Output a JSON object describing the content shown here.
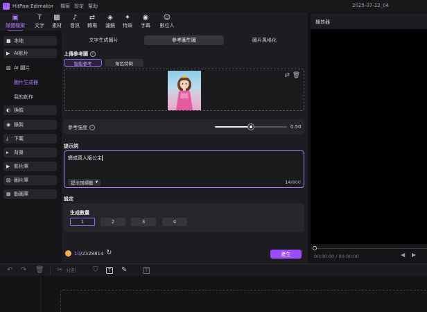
{
  "app": {
    "name": "HitPaw Edimakor",
    "menu": [
      "檔案",
      "設定",
      "幫助"
    ],
    "project_date": "2025-07-22_04"
  },
  "toolbar": [
    {
      "label": "媒體檔案",
      "icon": "media-icon",
      "glyph": "▣",
      "active": true
    },
    {
      "label": "文字",
      "icon": "text-icon",
      "glyph": "T"
    },
    {
      "label": "素材",
      "icon": "material-icon",
      "glyph": "▩"
    },
    {
      "label": "音訊",
      "icon": "audio-icon",
      "glyph": "♪"
    },
    {
      "label": "轉場",
      "icon": "transition-icon",
      "glyph": "⇄"
    },
    {
      "label": "濾鏡",
      "icon": "filter-icon",
      "glyph": "◈"
    },
    {
      "label": "特效",
      "icon": "effect-icon",
      "glyph": "✦"
    },
    {
      "label": "字幕",
      "icon": "subtitle-icon",
      "glyph": "◉"
    },
    {
      "label": "數位人",
      "icon": "digital-human-icon",
      "glyph": "☺"
    }
  ],
  "sidebar": {
    "items": [
      {
        "label": "本地",
        "icon": "folder-icon",
        "glyph": "■"
      },
      {
        "label": "AI影片",
        "icon": "ai-video-icon",
        "glyph": "▶"
      },
      {
        "label": "AI 圖片",
        "icon": "ai-image-icon",
        "glyph": "▨"
      },
      {
        "label": "換臉",
        "icon": "face-swap-icon",
        "glyph": "◐"
      },
      {
        "label": "錄製",
        "icon": "record-icon",
        "glyph": "◉"
      },
      {
        "label": "下載",
        "icon": "download-icon",
        "glyph": "⤓"
      },
      {
        "label": "背景",
        "icon": "background-icon",
        "glyph": "▸"
      },
      {
        "label": "影片庫",
        "icon": "video-library-icon",
        "glyph": "▶"
      },
      {
        "label": "圖片庫",
        "icon": "image-library-icon",
        "glyph": "▨"
      },
      {
        "label": "動圖庫",
        "icon": "gif-library-icon",
        "glyph": "▦"
      }
    ],
    "sub_items": [
      {
        "label": "圖片生成器",
        "active": true
      },
      {
        "label": "我的創作",
        "active": false
      }
    ]
  },
  "main": {
    "tabs": [
      {
        "label": "文字生成圖片",
        "active": false
      },
      {
        "label": "參考圖生圖",
        "active": true
      },
      {
        "label": "圖片風格化",
        "active": false
      }
    ],
    "upload_label": "上傳參考圖",
    "mode_buttons": {
      "smart": "智能參考",
      "role": "角色特徵"
    },
    "strength_label": "參考強度",
    "strength_value": "0.50",
    "strength_fraction": 0.5,
    "prompt_label": "提示詞",
    "prompt_text": "變成真人版公主",
    "prompt_template": "提示詞標籤",
    "char_count": "14",
    "char_max": "/800",
    "settings_label": "設定",
    "count_label": "生成數量",
    "counts": [
      "1",
      "2",
      "3",
      "4"
    ],
    "selected_count": "1",
    "credits_used": "10",
    "credits_total": "/2328814",
    "generate_label": "產生"
  },
  "player": {
    "title": "播放器",
    "time_current": "00:00:00",
    "time_total": "/ 00:00:00"
  },
  "timeline": {
    "split_label": "分割"
  },
  "colors": {
    "accent": "#9b6bff",
    "generate": "#9b4bff",
    "background": "#141417",
    "panel": "#1d1d21"
  }
}
